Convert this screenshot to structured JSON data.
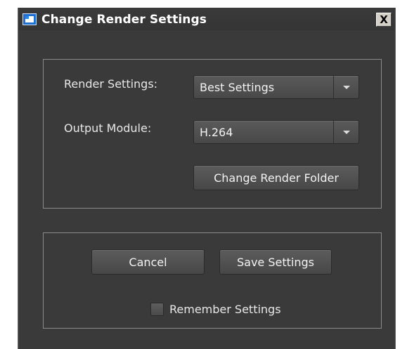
{
  "window": {
    "title": "Change Render Settings",
    "close_glyph": "X"
  },
  "render_settings": {
    "label": "Render Settings:",
    "value": "Best Settings"
  },
  "output_module": {
    "label": "Output Module:",
    "value": "H.264"
  },
  "buttons": {
    "change_folder": "Change Render Folder",
    "cancel": "Cancel",
    "save": "Save Settings"
  },
  "remember": {
    "label": "Remember Settings",
    "checked": false
  },
  "icons": {
    "app": "app-window-icon",
    "close": "close-icon",
    "dropdown": "chevron-down-icon"
  },
  "colors": {
    "background": "#3a3a3a",
    "text": "#e8e8e8",
    "control": "#505050",
    "group_border": "#8a8a8a"
  }
}
